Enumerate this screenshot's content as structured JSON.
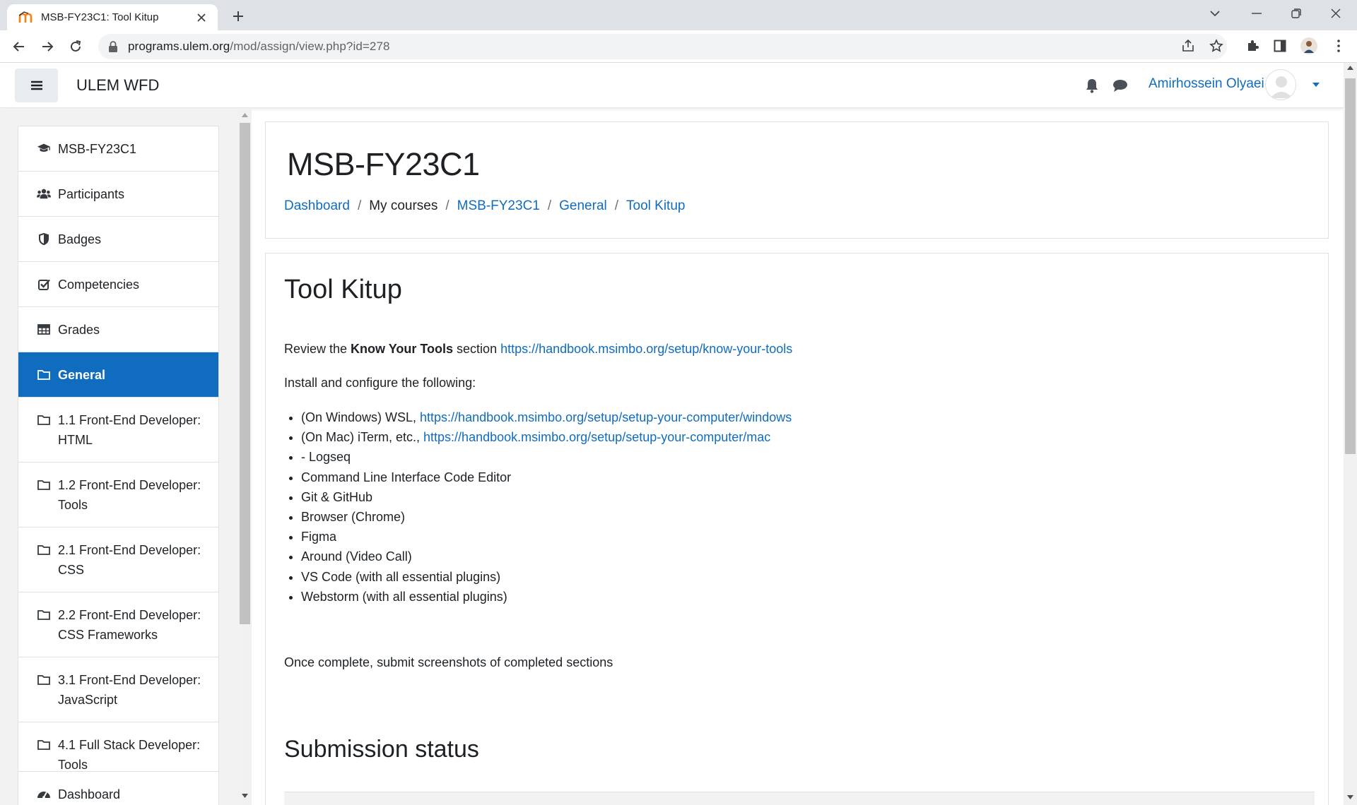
{
  "browser": {
    "tab_title": "MSB-FY23C1: Tool Kitup",
    "url_host": "programs.ulem.org",
    "url_path": "/mod/assign/view.php?id=278"
  },
  "navbar": {
    "site_name": "ULEM WFD",
    "user_name": "Amirhossein Olyaei"
  },
  "drawer": {
    "items": [
      {
        "label": "MSB-FY23C1",
        "icon": "graduation-cap-icon"
      },
      {
        "label": "Participants",
        "icon": "users-icon"
      },
      {
        "label": "Badges",
        "icon": "shield-icon"
      },
      {
        "label": "Competencies",
        "icon": "check-square-icon"
      },
      {
        "label": "Grades",
        "icon": "table-icon"
      },
      {
        "label": "General",
        "icon": "folder-icon",
        "active": true
      },
      {
        "label": "1.1 Front-End Developer: HTML",
        "icon": "folder-icon"
      },
      {
        "label": "1.2 Front-End Developer: Tools",
        "icon": "folder-icon"
      },
      {
        "label": "2.1 Front-End Developer: CSS",
        "icon": "folder-icon"
      },
      {
        "label": "2.2 Front-End Developer: CSS Frameworks",
        "icon": "folder-icon"
      },
      {
        "label": "3.1 Front-End Developer: JavaScript",
        "icon": "folder-icon"
      },
      {
        "label": "4.1 Full Stack Developer: Tools",
        "icon": "folder-icon"
      }
    ],
    "dashboard_label": "Dashboard"
  },
  "header": {
    "course_title": "MSB-FY23C1",
    "breadcrumb": [
      "Dashboard",
      "My courses",
      "MSB-FY23C1",
      "General",
      "Tool Kitup"
    ]
  },
  "content": {
    "title": "Tool Kitup",
    "review_prefix": "Review the ",
    "review_bold": "Know Your Tools",
    "review_suffix": " section ",
    "review_link": "https://handbook.msimbo.org/setup/know-your-tools",
    "install_text": "Install and configure the following:",
    "bullets": [
      {
        "text": "(On Windows) WSL, ",
        "link": "https://handbook.msimbo.org/setup/setup-your-computer/windows"
      },
      {
        "text": "(On Mac) iTerm, etc., ",
        "link": "https://handbook.msimbo.org/setup/setup-your-computer/mac"
      },
      {
        "text": "- Logseq"
      },
      {
        "text": "Command Line Interface Code Editor"
      },
      {
        "text": "Git & GitHub"
      },
      {
        "text": "Browser (Chrome)"
      },
      {
        "text": "Figma"
      },
      {
        "text": "Around (Video Call)"
      },
      {
        "text": "VS Code (with all essential plugins)"
      },
      {
        "text": "Webstorm (with all essential plugins)"
      }
    ],
    "submit_text": "Once complete, submit screenshots of completed sections",
    "submission_title": "Submission status"
  },
  "colors": {
    "accent": "#0f6cbf",
    "drawer_bg": "#f2f2f2"
  }
}
